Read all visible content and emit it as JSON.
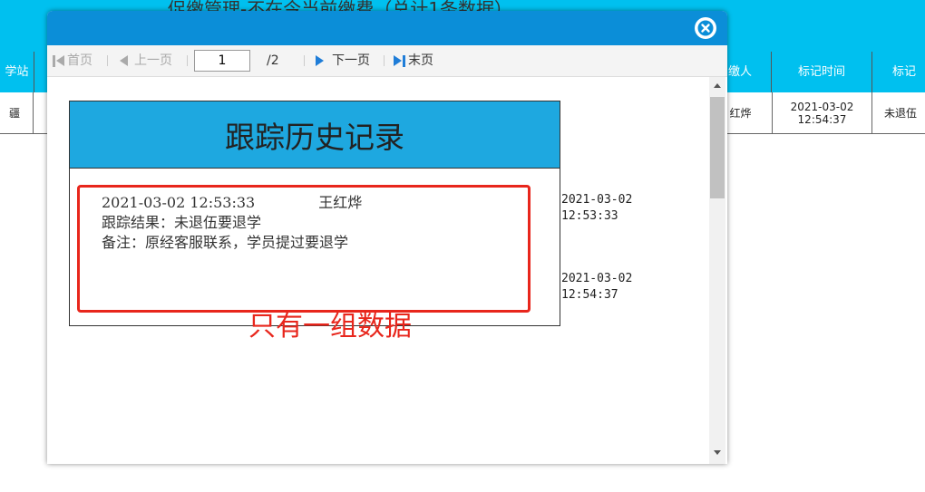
{
  "background": {
    "title": "促缴管理-不在今当前缴费（总计1条数据）",
    "columns_left": [
      "学站"
    ],
    "columns_right": [
      "缴人",
      "标记时间",
      "标记"
    ],
    "row": {
      "station": "疆",
      "payer": "红烨",
      "mark_time_date": "2021-03-02",
      "mark_time_clock": "12:54:37",
      "mark": "未退伍"
    },
    "header_color": "#00c0ef"
  },
  "modal": {
    "titlebar_color": "#0b8ed8",
    "close_icon": "close-circle-icon",
    "toolbar": {
      "first_label": "首页",
      "prev_label": "上一页",
      "page_value": "1",
      "page_total": "/2",
      "next_label": "下一页",
      "last_label": "末页"
    },
    "card": {
      "title": "跟踪历史记录",
      "header_color": "#1ea8e0",
      "record": {
        "datetime": "2021-03-02 12:53:33",
        "user": "王红烨",
        "result": "跟踪结果：未退伍要退学",
        "note": "备注：原经客服联系，学员提过要退学"
      }
    },
    "side_times": [
      {
        "date": "2021-03-02",
        "time": "12:53:33"
      },
      {
        "date": "2021-03-02",
        "time": "12:54:37"
      }
    ],
    "annotation": "只有一组数据",
    "annotation_color": "#e8261c"
  }
}
